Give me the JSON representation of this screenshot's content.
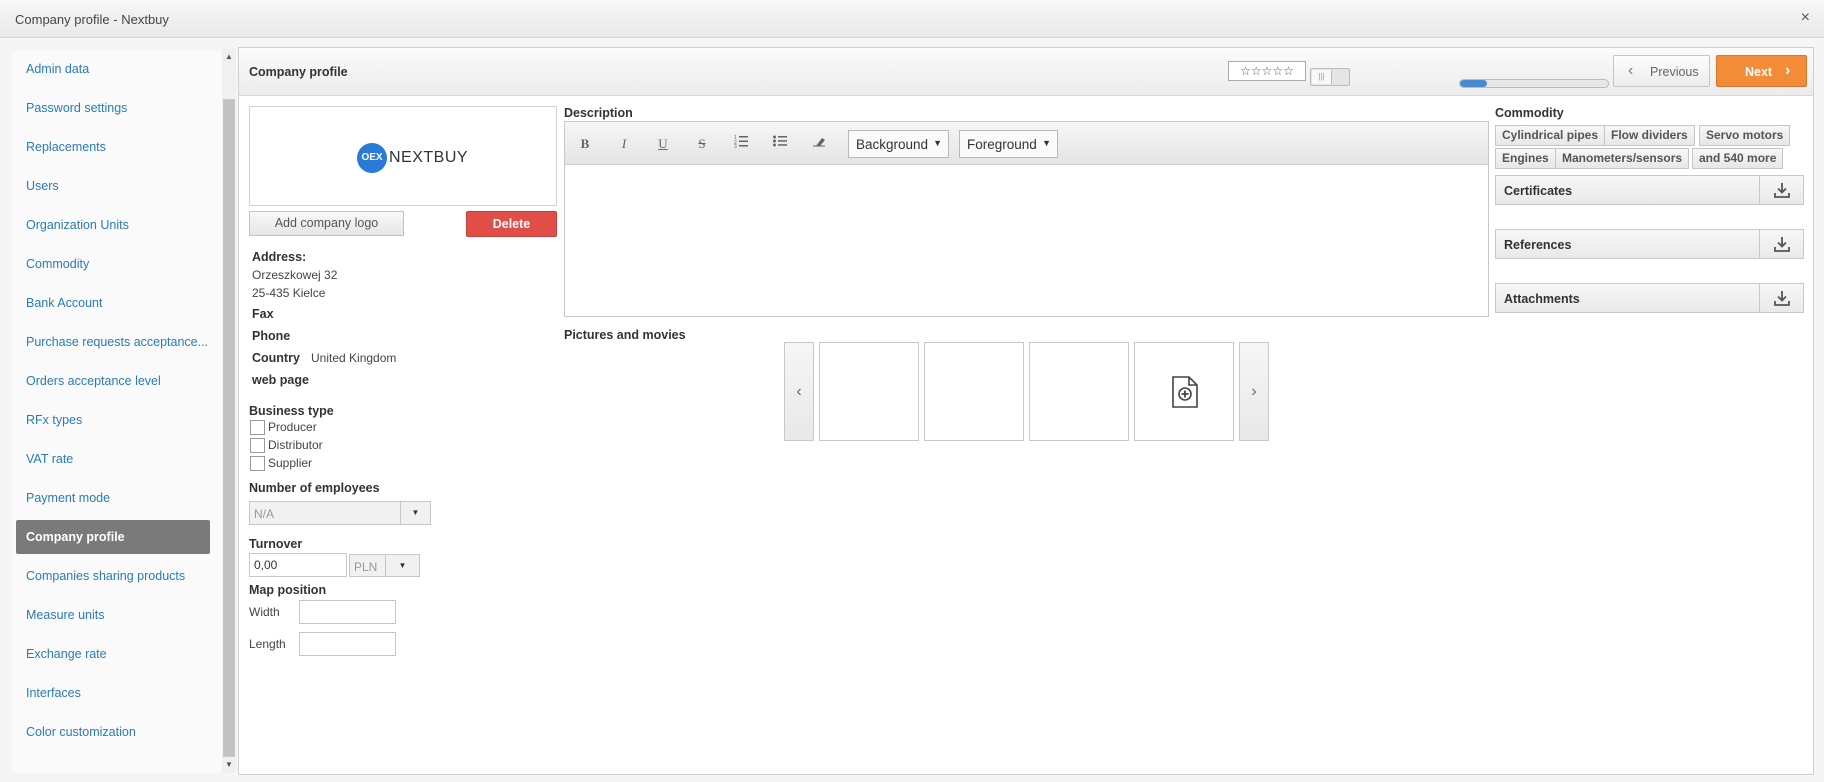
{
  "window": {
    "title": "Company profile - Nextbuy",
    "close_icon": "×"
  },
  "sidebar": {
    "items": [
      {
        "label": "Admin data"
      },
      {
        "label": "Password settings"
      },
      {
        "label": "Replacements"
      },
      {
        "label": "Users"
      },
      {
        "label": "Organization Units"
      },
      {
        "label": "Commodity"
      },
      {
        "label": "Bank Account"
      },
      {
        "label": "Purchase requests acceptance..."
      },
      {
        "label": "Orders acceptance level"
      },
      {
        "label": "RFx types"
      },
      {
        "label": "VAT rate"
      },
      {
        "label": "Payment mode"
      },
      {
        "label": "Company profile",
        "active": true
      },
      {
        "label": "Companies sharing products"
      },
      {
        "label": "Measure units"
      },
      {
        "label": "Exchange rate"
      },
      {
        "label": "Interfaces"
      },
      {
        "label": "Color customization"
      }
    ]
  },
  "header": {
    "title": "Company profile",
    "rating": "☆☆☆☆☆",
    "progress_fraction": 0.18,
    "previous_label": "Previous",
    "next_label": "Next",
    "colors": {
      "next": "#f28c38",
      "progress": "#4a8ad0"
    }
  },
  "company": {
    "logo_mark": "OEX",
    "logo_text": "NEXTBUY",
    "add_logo_label": "Add company logo",
    "delete_label": "Delete",
    "address_label": "Address:",
    "address_line1": "Orzeszkowej 32",
    "address_line2": "25-435 Kielce",
    "fax_label": "Fax",
    "phone_label": "Phone",
    "country_label": "Country",
    "country_value": "United Kingdom",
    "web_label": "web page",
    "business_type_label": "Business type",
    "business_types": [
      "Producer",
      "Distributor",
      "Supplier"
    ],
    "employees_label": "Number of employees",
    "employees_value": "N/A",
    "turnover_label": "Turnover",
    "turnover_value": "0,00",
    "currency": "PLN",
    "map_label": "Map position",
    "width_label": "Width",
    "length_label": "Length"
  },
  "description": {
    "label": "Description",
    "toolbar": {
      "bold": "B",
      "italic": "I",
      "underline": "U",
      "strike": "S",
      "background": "Background",
      "foreground": "Foreground"
    }
  },
  "pictures": {
    "label": "Pictures and movies"
  },
  "commodity": {
    "label": "Commodity",
    "tags": [
      "Cylindrical pipes",
      "Flow dividers",
      "Servo motors",
      "Engines",
      "Manometers/sensors",
      "and 540 more"
    ]
  },
  "sections": [
    "Certificates",
    "References",
    "Attachments"
  ]
}
